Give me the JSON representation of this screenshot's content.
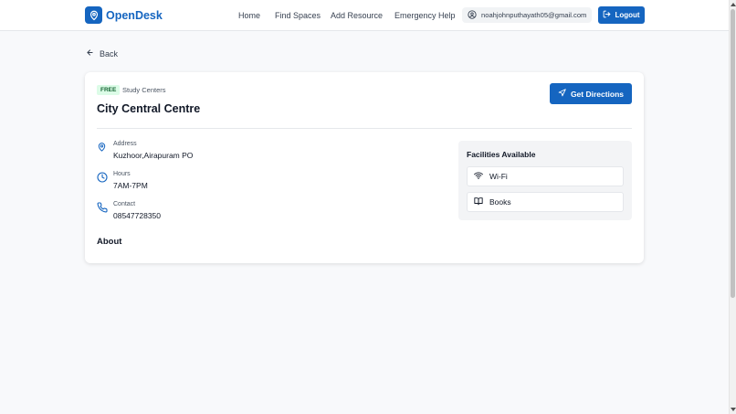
{
  "app": {
    "brand": "OpenDesk"
  },
  "nav": {
    "home": "Home",
    "find_spaces": "Find Spaces",
    "add_resource": "Add Resource",
    "emergency_help": "Emergency Help"
  },
  "user": {
    "email": "noahjohnputhayath05@gmail.com",
    "logout_label": "Logout"
  },
  "page": {
    "back_label": "Back"
  },
  "space": {
    "badge": "FREE",
    "category": "Study Centers",
    "name": "City Central Centre",
    "directions_label": "Get Directions",
    "address": {
      "label": "Address",
      "value": "Kuzhoor,Airapuram PO"
    },
    "hours": {
      "label": "Hours",
      "value": "7AM-7PM"
    },
    "contact": {
      "label": "Contact",
      "value": "08547728350"
    },
    "about_heading": "About"
  },
  "facilities": {
    "title": "Facilities Available",
    "items": [
      {
        "label": "Wi-Fi",
        "icon": "wifi-icon"
      },
      {
        "label": "Books",
        "icon": "book-icon"
      }
    ]
  },
  "colors": {
    "accent": "#1565c0",
    "free_badge_bg": "#dcfce7",
    "free_badge_text": "#166534"
  }
}
